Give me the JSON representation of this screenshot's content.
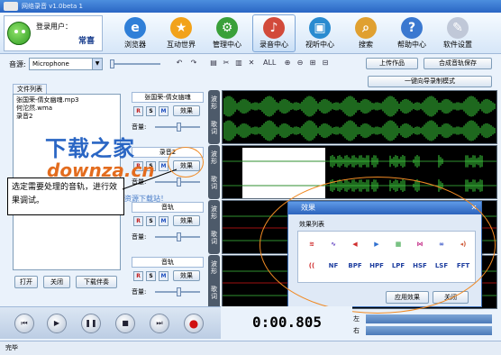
{
  "titlebar": {
    "title": "网络录音 v1.0beta 1"
  },
  "user": {
    "label": "登录用户：",
    "name": "常喜"
  },
  "nav": [
    {
      "label": "浏览器",
      "icon": "browser-icon",
      "color": "#2f7fd8",
      "glyph": "e"
    },
    {
      "label": "互动世界",
      "icon": "star-icon",
      "color": "#f2a21a",
      "glyph": "★"
    },
    {
      "label": "管理中心",
      "icon": "gear-icon",
      "color": "#3aa03a",
      "glyph": "⚙"
    },
    {
      "label": "录音中心",
      "icon": "microphone-icon",
      "color": "#d24a3a",
      "glyph": "♪"
    },
    {
      "label": "视听中心",
      "icon": "monitor-icon",
      "color": "#2a8bd0",
      "glyph": "▣"
    },
    {
      "label": "搜索",
      "icon": "search-icon",
      "color": "#e0a030",
      "glyph": "⌕"
    },
    {
      "label": "帮助中心",
      "icon": "help-icon",
      "color": "#3a78d0",
      "glyph": "?"
    },
    {
      "label": "软件设置",
      "icon": "settings-icon",
      "color": "#c0c8d8",
      "glyph": "✎"
    }
  ],
  "toolbar": {
    "volume_label": "音源:",
    "source_value": "Microphone",
    "upload_label": "上传作品",
    "save_label": "合成音轨保存",
    "guide_label": "一键向导录制模式"
  },
  "filelist": {
    "tab": "文件列表",
    "items": [
      "张国荣-倩女幽魂.mp3",
      "何沱然.wma",
      "录音2"
    ],
    "open_label": "打开",
    "close_label": "关闭",
    "download_label": "下载伴奏"
  },
  "tracks": [
    {
      "name": "张国荣-倩女幽魂",
      "effect": "效果",
      "volume": "音量:",
      "side_top": "波形",
      "side_bottom": "歌词"
    },
    {
      "name": "录音2",
      "effect": "效果",
      "volume": "音量:",
      "side_top": "波形",
      "side_bottom": "歌词"
    },
    {
      "name": "音轨",
      "effect": "效果",
      "volume": "音量:",
      "side_top": "波形",
      "side_bottom": "歌词"
    },
    {
      "name": "音轨",
      "effect": "效果",
      "volume": "音量:",
      "side_top": "波形",
      "side_bottom": "歌词"
    }
  ],
  "rsm": [
    "R",
    "S",
    "M"
  ],
  "effect_dialog": {
    "title": "效果",
    "list_label": "效果列表",
    "row2": [
      "NF",
      "BPF",
      "HPF",
      "LPF",
      "HSF",
      "LSF",
      "FFT"
    ],
    "apply_label": "应用效果",
    "close_label": "关闭"
  },
  "transport": {
    "time": "0:00.805",
    "left_label": "左",
    "right_label": "右"
  },
  "status": "完毕",
  "overlay": {
    "watermark_main": "下载之家",
    "watermark_url": "downza.cn",
    "watermark_sub": "国内最专业的资源下载站！",
    "callout": "选定需要处理的音轨，进行效果调试。"
  }
}
